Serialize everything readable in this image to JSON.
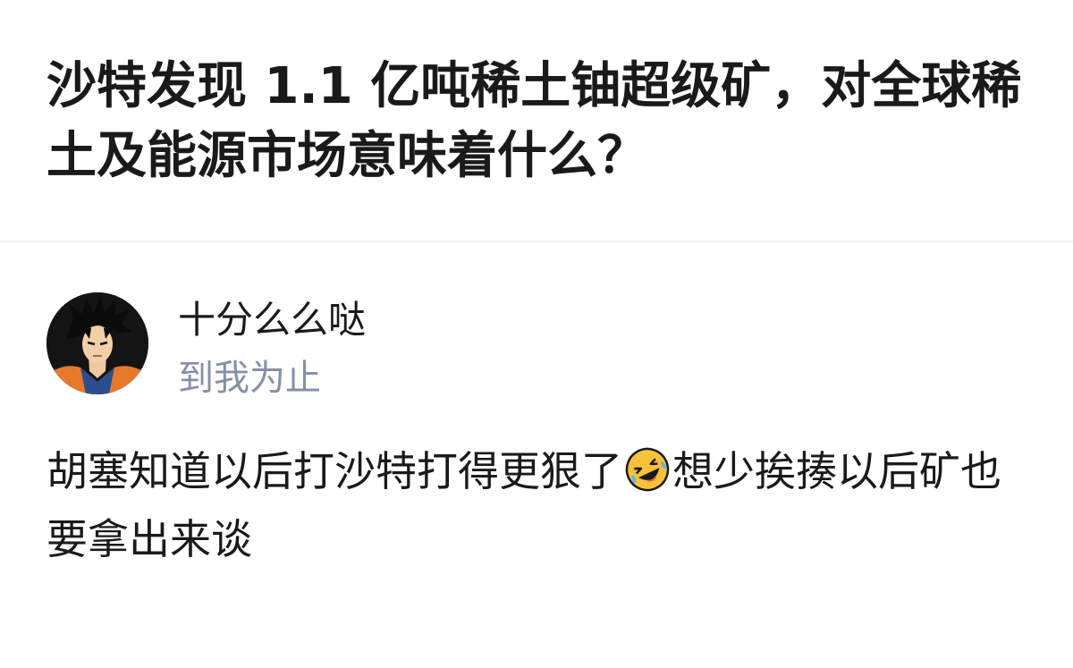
{
  "question": {
    "title": "沙特发现 1.1 亿吨稀土铀超级矿，对全球稀土及能源市场意味着什么？"
  },
  "author": {
    "name": "十分么么哒",
    "bio": "到我为止",
    "avatar_icon": "anime-character-avatar"
  },
  "answer": {
    "text_before_emoji": "胡塞知道以后打沙特打得更狠了",
    "emoji_icon": "rolling-on-floor-laughing-emoji",
    "text_after_emoji": "想少挨揍以后矿也要拿出来谈"
  },
  "colors": {
    "text_primary": "#1a1a1a",
    "text_secondary": "#8590a6",
    "divider": "#f2f2f2",
    "emoji_yellow": "#f7c23a"
  }
}
